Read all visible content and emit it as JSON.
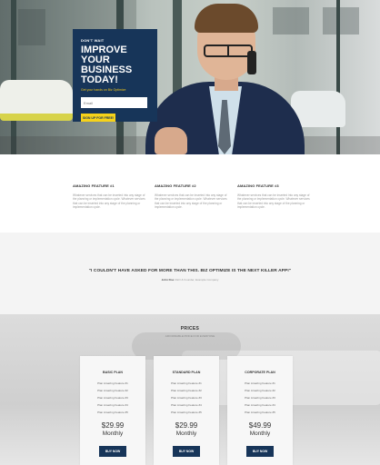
{
  "hero": {
    "eyebrow": "DON'T WAIT",
    "title": "IMPROVE YOUR BUSINESS TODAY!",
    "subtitle": "Get your hands on Biz Optimize",
    "email_placeholder": "Email",
    "button_label": "SIGN UP FOR FREE!",
    "colors": {
      "box": "#173559",
      "accent": "#f6d21a"
    }
  },
  "features": [
    {
      "title": "AMAZING FEATURE #1",
      "text": "Whatever services that can be inserted into any stage of the planning or implementation cycle. Whatever services that can be inserted into any stage of the planning or implementation cycle."
    },
    {
      "title": "AMAZING FEATURE #2",
      "text": "Whatever services that can be inserted into any stage of the planning or implementation cycle. Whatever services that can be inserted into any stage of the planning or implementation cycle."
    },
    {
      "title": "AMAZING FEATURE #3",
      "text": "Whatever services that can be inserted into any stage of the planning or implementation cycle. Whatever services that can be inserted into any stage of the planning or implementation cycle."
    }
  ],
  "testimonial": {
    "quote": "\"I COULDN'T HAVE ASKED FOR MORE THAN THIS. BIZ OPTIMIZE IS THE NEXT KILLER APP!\"",
    "author": "John Doe",
    "role": "CEO & Founder, Example Company"
  },
  "prices": {
    "title": "PRICES",
    "subtitle": "AFFORDABLE PRICE FOR EVERYONE",
    "plans": [
      {
        "name": "BASIC PLAN",
        "features": [
          "Plan Amazing Feature #1",
          "Plan Amazing Feature #2",
          "Plan Amazing Feature #3",
          "Plan Amazing Feature #4",
          "Plan Amazing Feature #5"
        ],
        "price": "$29.99",
        "period": "Monthly",
        "button_label": "BUY NOW"
      },
      {
        "name": "STANDARD PLAN",
        "features": [
          "Plan Amazing Feature #1",
          "Plan Amazing Feature #2",
          "Plan Amazing Feature #3",
          "Plan Amazing Feature #4",
          "Plan Amazing Feature #5"
        ],
        "price": "$29.99",
        "period": "Monthly",
        "button_label": "BUY NOW"
      },
      {
        "name": "CORPORATE PLAN",
        "features": [
          "Plan Amazing Feature #1",
          "Plan Amazing Feature #2",
          "Plan Amazing Feature #3",
          "Plan Amazing Feature #4",
          "Plan Amazing Feature #5"
        ],
        "price": "$49.99",
        "period": "Monthly",
        "button_label": "BUY NOW"
      }
    ]
  }
}
